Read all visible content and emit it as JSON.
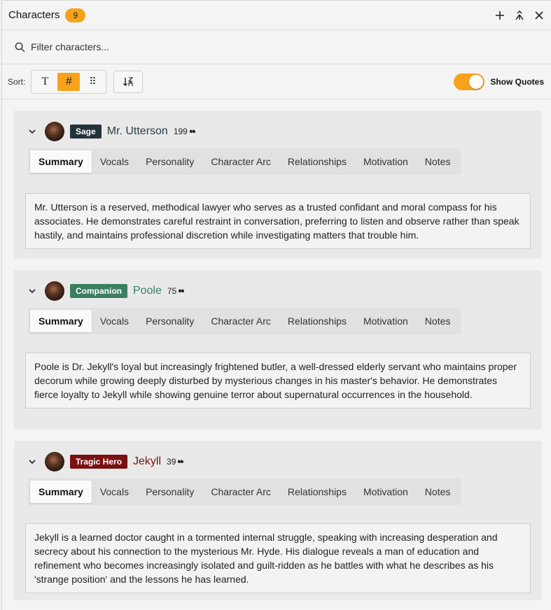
{
  "header": {
    "title": "Characters",
    "count": "9",
    "icons": [
      "plus-icon",
      "merge-icon",
      "close-icon"
    ]
  },
  "search": {
    "placeholder": "Filter characters..."
  },
  "sort": {
    "label": "Sort:",
    "options": [
      "T",
      "#",
      "⠿"
    ],
    "active": "#",
    "direction_icon": "sort-direction-icon"
  },
  "quotes_toggle": {
    "label": "Show Quotes",
    "on": true
  },
  "colors": {
    "accent": "#f7a21b",
    "sage": "#23333a",
    "companion": "#3b7f60",
    "tragic_hero": "#7a1010"
  },
  "tabs": [
    "Summary",
    "Vocals",
    "Personality",
    "Character Arc",
    "Relationships",
    "Motivation",
    "Notes"
  ],
  "characters": [
    {
      "role": "Sage",
      "name": "Mr. Utterson",
      "quotes": "199",
      "role_color": "#23333a",
      "name_color": "#2a3a44",
      "summary": "Mr. Utterson is a reserved, methodical lawyer who serves as a trusted confidant and moral compass for his associates. He demonstrates careful restraint in conversation, preferring to listen and observe rather than speak hastily, and maintains professional discretion while investigating matters that trouble him."
    },
    {
      "role": "Companion",
      "name": "Poole",
      "quotes": "75",
      "role_color": "#3b7f60",
      "name_color": "#3b7f60",
      "summary": "Poole is Dr. Jekyll's loyal but increasingly frightened butler, a well-dressed elderly servant who maintains proper decorum while growing deeply disturbed by mysterious changes in his master's behavior. He demonstrates fierce loyalty to Jekyll while showing genuine terror about supernatural occurrences in the household."
    },
    {
      "role": "Tragic Hero",
      "name": "Jekyll",
      "quotes": "39",
      "role_color": "#7a1010",
      "name_color": "#7a1010",
      "summary": "Jekyll is a learned doctor caught in a tormented internal struggle, speaking with increasing desperation and secrecy about his connection to the mysterious Mr. Hyde. His dialogue reveals a man of education and refinement who becomes increasingly isolated and guilt-ridden as he battles with what he describes as his 'strange position' and the lessons he has learned."
    }
  ]
}
